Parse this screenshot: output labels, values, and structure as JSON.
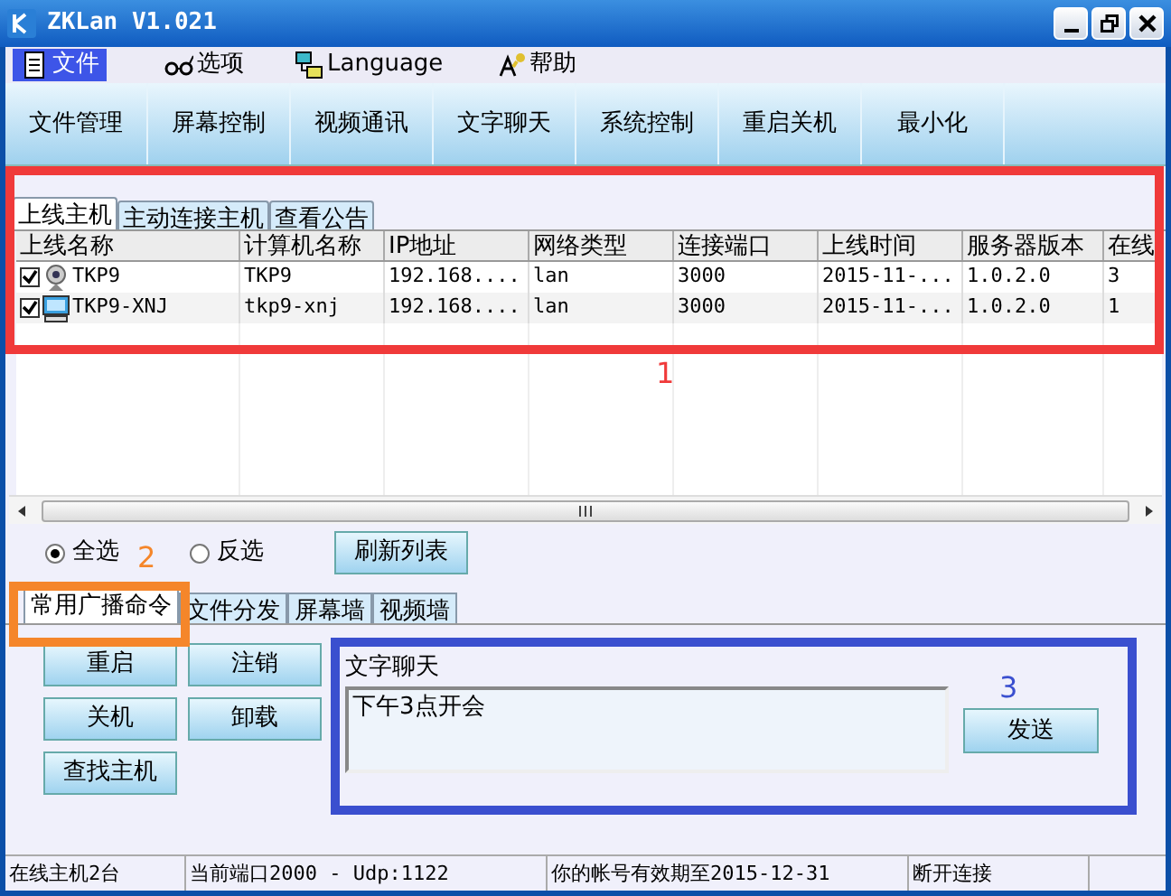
{
  "window": {
    "title": "ZKLan V1.021"
  },
  "menu": [
    {
      "label": "文件",
      "selected": true
    },
    {
      "label": "选项",
      "selected": false
    },
    {
      "label": "Language",
      "selected": false
    },
    {
      "label": "帮助",
      "selected": false
    }
  ],
  "toolbar": [
    "文件管理",
    "屏幕控制",
    "视频通讯",
    "文字聊天",
    "系统控制",
    "重启关机",
    "最小化"
  ],
  "host_tabs": [
    {
      "label": "上线主机",
      "selected": true
    },
    {
      "label": "主动连接主机",
      "selected": false
    },
    {
      "label": "查看公告",
      "selected": false
    }
  ],
  "table": {
    "columns": [
      "上线名称",
      "计算机名称",
      "IP地址",
      "网络类型",
      "连接端口",
      "上线时间",
      "服务器版本",
      "在线"
    ],
    "rows": [
      {
        "checked": true,
        "kind": "webcam",
        "cells": [
          "TKP9",
          "TKP9",
          "192.168....",
          "lan",
          "3000",
          "2015-11-...",
          "1.0.2.0",
          "3"
        ]
      },
      {
        "checked": true,
        "kind": "computer",
        "cells": [
          "TKP9-XNJ",
          "tkp9-xnj",
          "192.168....",
          "lan",
          "3000",
          "2015-11-...",
          "1.0.2.0",
          "1"
        ]
      }
    ]
  },
  "select_options": [
    {
      "label": "全选",
      "selected": true
    },
    {
      "label": "反选",
      "selected": false
    }
  ],
  "refresh_button": "刷新列表",
  "command_tabs": [
    {
      "label": "常用广播命令",
      "selected": true
    },
    {
      "label": "文件分发",
      "selected": false
    },
    {
      "label": "屏幕墙",
      "selected": false
    },
    {
      "label": "视频墙",
      "selected": false
    }
  ],
  "command_buttons": [
    "重启",
    "注销",
    "关机",
    "卸载",
    "查找主机"
  ],
  "chat": {
    "title": "文字聊天",
    "message": "下午3点开会",
    "send_button": "发送"
  },
  "status_bar": [
    "在线主机2台",
    "当前端口2000 - Udp:1122",
    "你的帐号有效期至2015-12-31",
    "断开连接"
  ],
  "annotations": [
    {
      "label": "1",
      "color": "#f03a3a"
    },
    {
      "label": "2",
      "color": "#f5862a"
    },
    {
      "label": "3",
      "color": "#3a4fcf"
    }
  ]
}
